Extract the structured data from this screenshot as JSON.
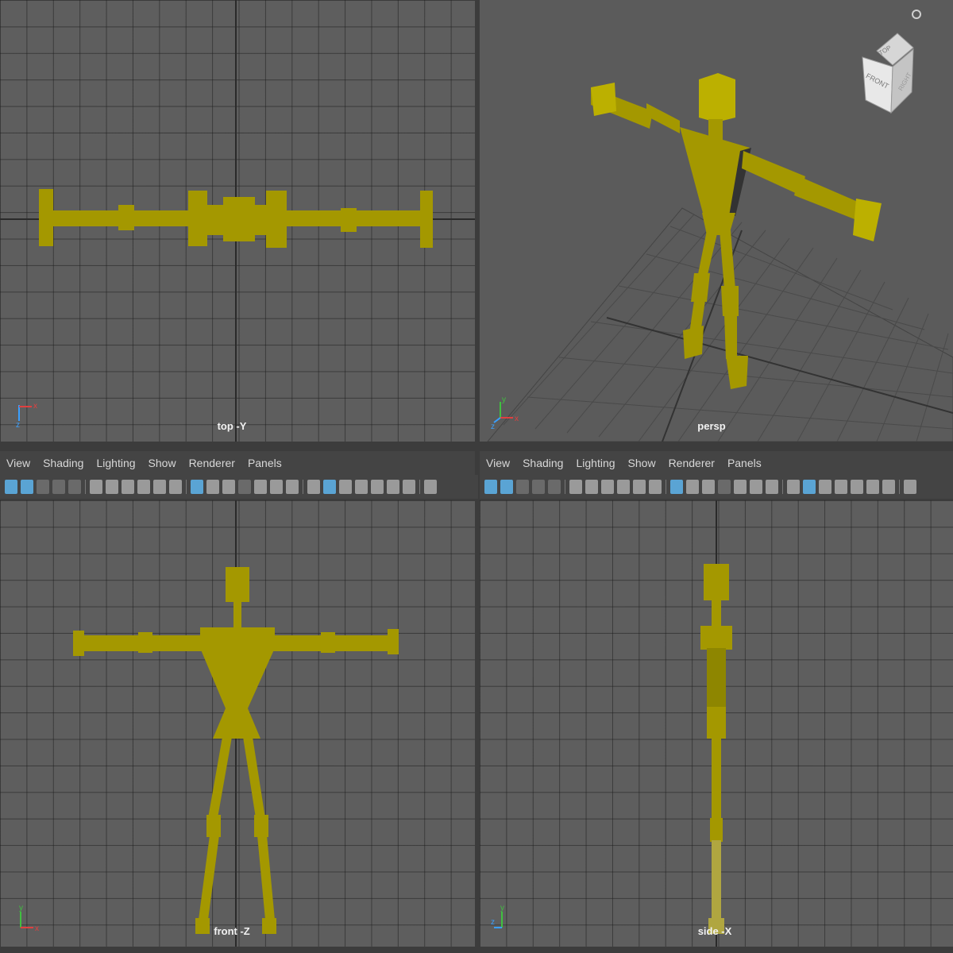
{
  "viewports": {
    "top": {
      "label": "top -Y"
    },
    "persp": {
      "label": "persp"
    },
    "front": {
      "label": "front -Z"
    },
    "side": {
      "label": "side -X"
    }
  },
  "panel_menu": [
    "View",
    "Shading",
    "Lighting",
    "Show",
    "Renderer",
    "Panels"
  ],
  "view_cube": {
    "top": "TOP",
    "front": "FRONT",
    "right": "RIGHT"
  },
  "axes": {
    "x": "x",
    "y": "y",
    "z": "z"
  },
  "colors": {
    "model": "#a49800",
    "grid_bg": "#5e5e5e",
    "active_icon": "#5aa4d4"
  }
}
